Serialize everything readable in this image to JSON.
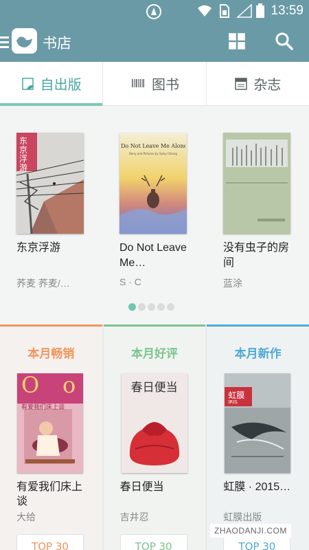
{
  "status_bar": {
    "time": "13:59"
  },
  "app_bar": {
    "title": "书店"
  },
  "tabs": [
    {
      "label": "自出版",
      "active": true
    },
    {
      "label": "图书",
      "active": false
    },
    {
      "label": "杂志",
      "active": false
    }
  ],
  "featured": {
    "books": [
      {
        "title": "东京浮游",
        "author": "荞麦  荞麦/…",
        "cover_text": "东京浮游"
      },
      {
        "title": "Do Not Leave Me…",
        "author": "S · C",
        "cover_title": "Do Not Leave Me Alone",
        "cover_subtitle": "Story and Pictures by Sylvy Chiang"
      },
      {
        "title": "没有虫子的房间",
        "author": "蓝涂"
      }
    ],
    "pages": 5,
    "current_page": 1
  },
  "columns": [
    {
      "header": "本月畅销",
      "color": "#f0955c",
      "book_title": "有爱我们床上谈",
      "author": "大给",
      "cover_text": "有爱我们床上谈",
      "top_label": "TOP 30"
    },
    {
      "header": "本月好评",
      "color": "#7cc48e",
      "book_title": "春日便当",
      "author": "吉井忍",
      "cover_text": "春日便当",
      "top_label": "TOP 30"
    },
    {
      "header": "本月新作",
      "color": "#4fa9d4",
      "book_title": "虹膜 · 2015…",
      "author": "虹膜出版",
      "cover_text": "虹膜",
      "cover_sub": "IRIS",
      "top_label": "TOP 30"
    }
  ],
  "watermark": "ZHAODANJI.COM"
}
